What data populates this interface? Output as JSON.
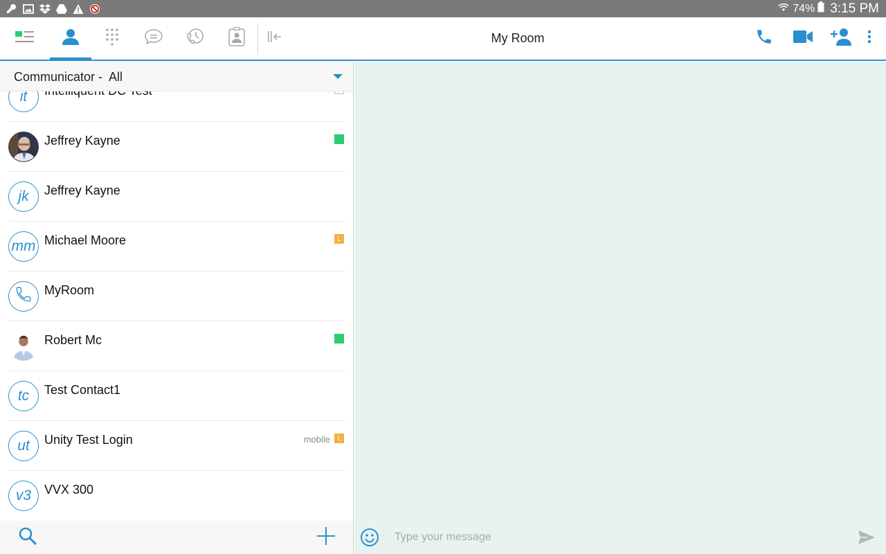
{
  "status_bar": {
    "left_icons": [
      "wrench-icon",
      "image-icon",
      "dropbox-icon",
      "drive-icon",
      "warning-icon",
      "blocked-icon"
    ],
    "wifi_icon": "wifi-icon",
    "battery_percent": "74%",
    "battery_icon": "battery-icon",
    "time": "3:15 PM"
  },
  "app_bar": {
    "title": "My Room",
    "nav_tabs": [
      {
        "name": "menu",
        "icon": "menu-presence-icon",
        "active": false
      },
      {
        "name": "contacts",
        "icon": "person-icon",
        "active": true
      },
      {
        "name": "dialpad",
        "icon": "dialpad-icon",
        "active": false
      },
      {
        "name": "messages",
        "icon": "chat-icon",
        "active": false
      },
      {
        "name": "history",
        "icon": "call-history-icon",
        "active": false
      },
      {
        "name": "directory",
        "icon": "contact-card-icon",
        "active": false
      },
      {
        "name": "collapse",
        "icon": "collapse-panel-icon",
        "active": false
      }
    ],
    "actions": [
      "phone-icon",
      "video-icon",
      "add-contact-icon",
      "more-vert-icon"
    ]
  },
  "filter": {
    "label": "Communicator -  All"
  },
  "contacts": [
    {
      "initials": "it",
      "name": "Intelliquent DC Test",
      "presence": "white",
      "partial": true
    },
    {
      "initials": "",
      "name": "Jeffrey Kayne",
      "presence": "green",
      "photo": true
    },
    {
      "initials": "jk",
      "name": "Jeffrey Kayne",
      "presence": ""
    },
    {
      "initials": "mm",
      "name": "Michael Moore",
      "presence": "orange",
      "presence_letter": "L"
    },
    {
      "initials": "",
      "name": "MyRoom",
      "presence": "",
      "phone_avatar": true
    },
    {
      "initials": "",
      "name": "Robert Mc",
      "presence": "green",
      "photo": true
    },
    {
      "initials": "tc",
      "name": "Test Contact1",
      "presence": ""
    },
    {
      "initials": "ut",
      "name": "Unity Test Login",
      "presence": "orange",
      "presence_letter": "L",
      "device": "mobile"
    },
    {
      "initials": "v3",
      "name": "VVX 300",
      "presence": ""
    }
  ],
  "bottom_bar": {
    "search_icon": "search-icon",
    "add_icon": "plus-icon"
  },
  "composer": {
    "placeholder": "Type your message",
    "value": "",
    "emoji_icon": "smiley-icon",
    "send_icon": "send-icon"
  },
  "colors": {
    "accent": "#2a8fce",
    "status_bar": "#7a7a7a",
    "chat_bg": "#e8f3ef",
    "presence_available": "#2ecc71",
    "presence_away": "#f5b041"
  }
}
